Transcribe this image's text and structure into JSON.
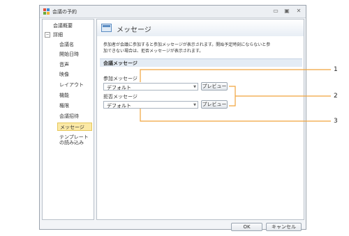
{
  "window": {
    "title": "会議の予約"
  },
  "sidebar": {
    "items": [
      {
        "label": "会議概要"
      },
      {
        "label": "詳細",
        "toggle": "⊟"
      },
      {
        "label": "会議名"
      },
      {
        "label": "開始日時"
      },
      {
        "label": "音声"
      },
      {
        "label": "映像"
      },
      {
        "label": "レイアウト"
      },
      {
        "label": "機能"
      },
      {
        "label": "権限"
      },
      {
        "label": "会議招待"
      },
      {
        "label": "メッセージ",
        "selected": true
      },
      {
        "label": "テンプレート"
      },
      {
        "label": "の読み込み"
      }
    ]
  },
  "content": {
    "title": "メッセージ",
    "description_line1": "参加者が会議に参加すると参加メッセージが表示されます。開始予定時刻にならないと参",
    "description_line2": "加できない場合は、拒否メッセージが表示されます。",
    "section_title": "会議メッセージ",
    "join": {
      "label": "参加メッセージ",
      "value": "デフォルト",
      "preview": "プレビュー"
    },
    "reject": {
      "label": "拒否メッセージ",
      "value": "デフォルト",
      "preview": "プレビュー"
    }
  },
  "footer": {
    "ok": "OK",
    "cancel": "キャンセル"
  },
  "callouts": [
    "1",
    "2",
    "3"
  ],
  "colors": {
    "callout_line": "#f0a43c",
    "selected_bg": "#fbe9a6"
  }
}
